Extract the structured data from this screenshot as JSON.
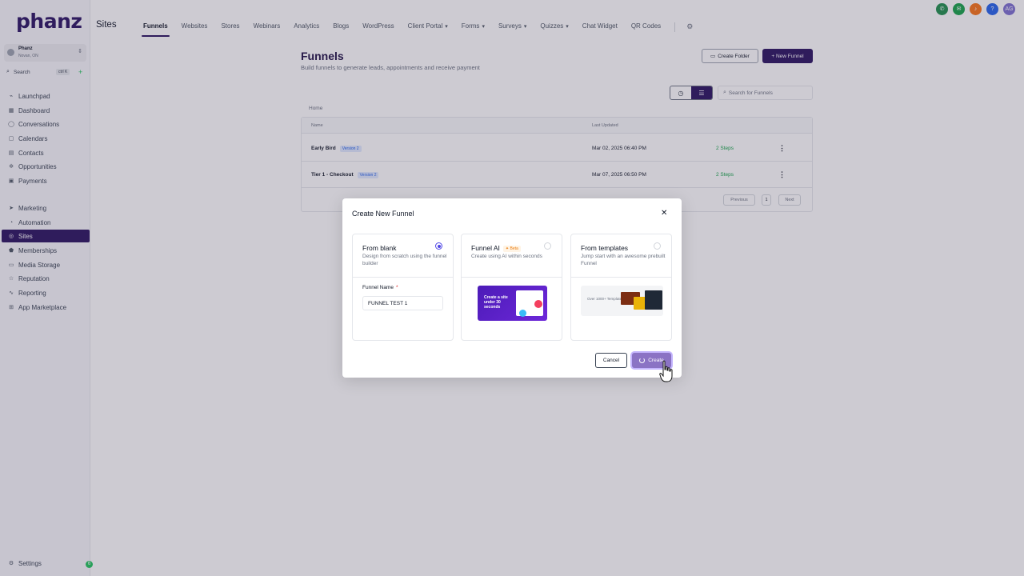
{
  "sidebar": {
    "logo": "phanz",
    "account": {
      "name": "Phanz",
      "location": "Novan, ON"
    },
    "search": {
      "label": "Search",
      "shortcut": "ctrl K"
    },
    "items": [
      {
        "label": "Launchpad",
        "icon": "rocket-icon",
        "glyph": "⌁"
      },
      {
        "label": "Dashboard",
        "icon": "dashboard-icon",
        "glyph": "▦"
      },
      {
        "label": "Conversations",
        "icon": "chat-icon",
        "glyph": "◯"
      },
      {
        "label": "Calendars",
        "icon": "calendar-icon",
        "glyph": "▢"
      },
      {
        "label": "Contacts",
        "icon": "contacts-icon",
        "glyph": "▤"
      },
      {
        "label": "Opportunities",
        "icon": "funnel-icon",
        "glyph": "✲"
      },
      {
        "label": "Payments",
        "icon": "payments-icon",
        "glyph": "▣"
      },
      {
        "label": "Marketing",
        "icon": "send-icon",
        "glyph": "➤"
      },
      {
        "label": "Automation",
        "icon": "automation-icon",
        "glyph": "◔"
      },
      {
        "label": "Sites",
        "icon": "globe-icon",
        "glyph": "◎"
      },
      {
        "label": "Memberships",
        "icon": "graduation-icon",
        "glyph": "⬟"
      },
      {
        "label": "Media Storage",
        "icon": "folder-icon",
        "glyph": "▭"
      },
      {
        "label": "Reputation",
        "icon": "star-icon",
        "glyph": "☆"
      },
      {
        "label": "Reporting",
        "icon": "chart-icon",
        "glyph": "∿"
      },
      {
        "label": "App Marketplace",
        "icon": "grid-icon",
        "glyph": "⊞"
      }
    ],
    "settings_label": "Settings",
    "settings_badge": "6"
  },
  "header": {
    "title": "Sites",
    "tabs": [
      {
        "label": "Funnels",
        "active": true,
        "caret": false
      },
      {
        "label": "Websites",
        "caret": false
      },
      {
        "label": "Stores",
        "caret": false
      },
      {
        "label": "Webinars",
        "caret": false
      },
      {
        "label": "Analytics",
        "caret": false
      },
      {
        "label": "Blogs",
        "caret": false
      },
      {
        "label": "WordPress",
        "caret": false
      },
      {
        "label": "Client Portal",
        "caret": true
      },
      {
        "label": "Forms",
        "caret": true
      },
      {
        "label": "Surveys",
        "caret": true
      },
      {
        "label": "Quizzes",
        "caret": true
      },
      {
        "label": "Chat Widget",
        "caret": false
      },
      {
        "label": "QR Codes",
        "caret": false
      }
    ],
    "top_icons": [
      {
        "name": "phone-icon",
        "glyph": "✆",
        "color": "#1f8f4e"
      },
      {
        "name": "megaphone-icon",
        "glyph": "✉",
        "color": "#16a34a"
      },
      {
        "name": "bell-icon",
        "glyph": "♪",
        "color": "#f97316"
      },
      {
        "name": "help-icon",
        "glyph": "?",
        "color": "#2563eb"
      },
      {
        "name": "avatar",
        "glyph": "AG",
        "color": "#7c6fd0"
      }
    ]
  },
  "main": {
    "title": "Funnels",
    "subtitle": "Build funnels to generate leads, appointments and receive payment",
    "create_folder": "Create Folder",
    "new_funnel": "+ New Funnel",
    "search_placeholder": "Search for Funnels",
    "breadcrumb": "Home",
    "columns": {
      "name": "Name",
      "updated": "Last Updated"
    },
    "rows": [
      {
        "name": "Early Bird",
        "version": "Version 2",
        "updated": "Mar 02, 2025 06:40 PM",
        "steps": "2 Steps"
      },
      {
        "name": "Tier 1 - Checkout",
        "version": "Version 2",
        "updated": "Mar 07, 2025 06:50 PM",
        "steps": "2 Steps"
      }
    ],
    "pagination": {
      "previous": "Previous",
      "page": "1",
      "next": "Next"
    }
  },
  "modal": {
    "title": "Create New Funnel",
    "options": [
      {
        "title": "From blank",
        "desc": "Design from scratch using the funnel builder",
        "selected": true
      },
      {
        "title": "Funnel AI",
        "badge": "Beta",
        "desc": "Create using AI within seconds",
        "image_text": "Create a site under 30 seconds"
      },
      {
        "title": "From templates",
        "desc": "Jump start with an awesome prebuilt Funnel",
        "image_text": "Over 1000+ Templates"
      }
    ],
    "funnel_name_label": "Funnel Name",
    "required_mark": "*",
    "funnel_name_value": "FUNNEL TEST 1",
    "cancel": "Cancel",
    "create": "Create"
  },
  "colors": {
    "brand": "#2b1361",
    "overlay": "rgba(60,56,80,0.26)",
    "create_loading": "#8b73c4"
  }
}
